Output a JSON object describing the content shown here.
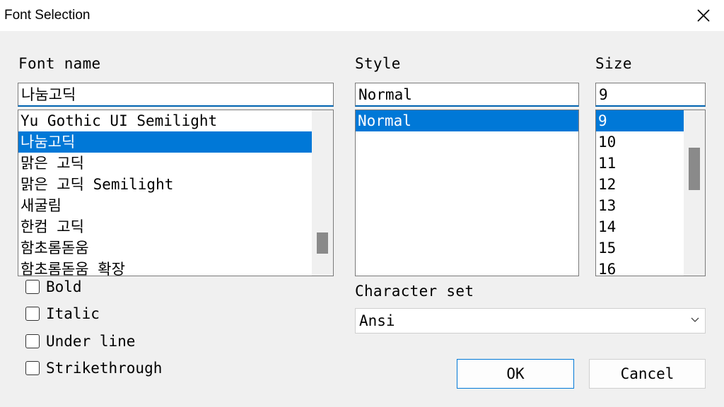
{
  "window": {
    "title": "Font Selection"
  },
  "font_name": {
    "label": "Font name",
    "value": "나눔고딕",
    "items": [
      "Yu Gothic UI Semilight",
      "나눔고딕",
      "맑은 고딕",
      "맑은 고딕 Semilight",
      "새굴림",
      "한컴 고딕",
      "함초롬돋움",
      "함초롬돋움 확장"
    ],
    "selected_index": 1
  },
  "style": {
    "label": "Style",
    "value": "Normal",
    "items": [
      "Normal"
    ],
    "selected_index": 0
  },
  "size": {
    "label": "Size",
    "value": "9",
    "items": [
      "9",
      "10",
      "11",
      "12",
      "13",
      "14",
      "15",
      "16"
    ],
    "selected_index": 0
  },
  "effects": [
    {
      "label": "Bold",
      "checked": false
    },
    {
      "label": "Italic",
      "checked": false
    },
    {
      "label": "Under line",
      "checked": false
    },
    {
      "label": "Strikethrough",
      "checked": false
    }
  ],
  "charset": {
    "label": "Character set",
    "value": "Ansi"
  },
  "buttons": {
    "ok": "OK",
    "cancel": "Cancel"
  },
  "colors": {
    "selection": "#0078d7",
    "focus_underline": "#0063b1",
    "background": "#f0f0f0"
  },
  "icons": {
    "close": "close-icon",
    "dropdown": "chevron-down-icon"
  }
}
